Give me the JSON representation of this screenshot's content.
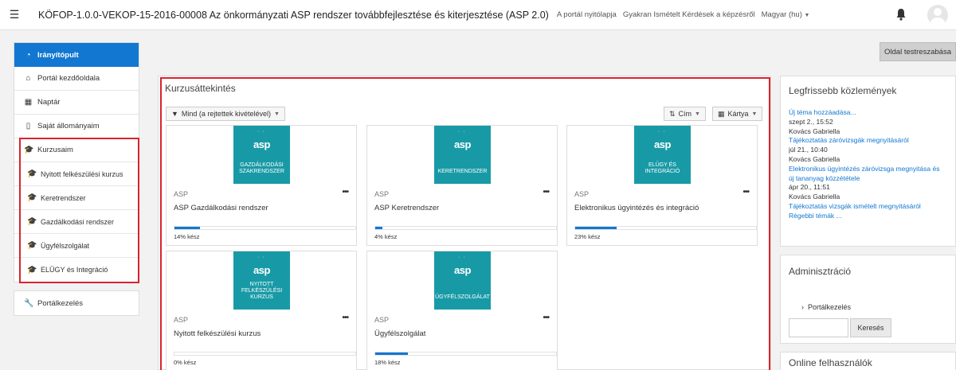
{
  "navbar": {
    "title": "KÖFOP-1.0.0-VEKOP-15-2016-00008 Az önkormányzati ASP rendszer továbbfejlesztése és kiterjesztése (ASP 2.0)",
    "links": [
      "A portál nyitólapja",
      "Gyakran Ismételt Kérdések a képzésről",
      "Magyar (hu)"
    ],
    "icons": [
      "hamburger-icon",
      "bell-icon",
      "avatar"
    ]
  },
  "leftnav": {
    "dashboard": "Irányítópult",
    "portal_home": "Portál kezdőoldala",
    "calendar": "Naptár",
    "files": "Saját állományaim",
    "my_courses": "Kurzusaim",
    "courses": [
      "Nyitott felkészülési kurzus",
      "Keretrendszer",
      "Gazdálkodási rendszer",
      "Ügyfélszolgálat",
      "ELÜGY és Integráció"
    ],
    "admin": "Portálkezelés"
  },
  "customize_button": "Oldal testreszabása",
  "overview": {
    "title": "Kurzusáttekintés",
    "filter": "Mind (a rejtettek kivételével)",
    "sort": "Cím",
    "view": "Kártya",
    "cards": [
      {
        "category": "ASP",
        "name": "ASP Gazdálkodási rendszer",
        "progress": 14,
        "progress_text": "14% kész",
        "image_logo": "asp",
        "image_caption": [
          "GAZDÁLKODÁSI",
          "SZAKRENDSZER"
        ]
      },
      {
        "category": "ASP",
        "name": "ASP Keretrendszer",
        "progress": 4,
        "progress_text": "4% kész",
        "image_logo": "asp",
        "image_caption": [
          "KERETRENDSZER"
        ]
      },
      {
        "category": "ASP",
        "name": "Elektronikus ügyintézés és integráció",
        "progress": 23,
        "progress_text": "23% kész",
        "image_logo": "asp",
        "image_caption": [
          "ELÜGY ÉS",
          "INTEGRÁCIÓ"
        ]
      },
      {
        "category": "ASP",
        "name": "Nyitott felkészülési kurzus",
        "progress": 0,
        "progress_text": "0% kész",
        "image_logo": "asp",
        "image_caption": [
          "NYITOTT",
          "FELKÉSZÜLÉSI",
          "KURZUS"
        ]
      },
      {
        "category": "ASP",
        "name": "Ügyfélszolgálat",
        "progress": 18,
        "progress_text": "18% kész",
        "image_logo": "asp",
        "image_caption": [
          "ÜGYFÉLSZOLGÁLAT"
        ]
      }
    ]
  },
  "news": {
    "title": "Legfrissebb közlemények",
    "lines": [
      {
        "text": "Új téma hozzáadása...",
        "link": true
      },
      {
        "text": "szept 2., 15:52",
        "link": false
      },
      {
        "text": "Kovács Gabriella",
        "link": false
      },
      {
        "text": "Tájékoztatás záróvizsgák megnyitásáról",
        "link": true
      },
      {
        "text": "júl 21., 10:40",
        "link": false
      },
      {
        "text": "Kovács Gabriella",
        "link": false
      },
      {
        "text": "Elektronikus ügyintézés záróvizsga megnyitása és",
        "link": true
      },
      {
        "text": "új tananyag közzététele",
        "link": true
      },
      {
        "text": "ápr 20., 11:51",
        "link": false
      },
      {
        "text": "Kovács Gabriella",
        "link": false
      },
      {
        "text": "Tájékoztatás vizsgák ismételt megnyitásáról",
        "link": true
      },
      {
        "text": "Régebbi témák ...",
        "link": true
      }
    ]
  },
  "admin_block": {
    "title": "Adminisztráció",
    "item": "Portálkezelés",
    "search_button": "Keresés"
  },
  "online_block": {
    "title": "Online felhasználók"
  },
  "colors": {
    "accent": "#1177d1",
    "card_image": "#189aa6",
    "highlight": "#d9232d"
  }
}
